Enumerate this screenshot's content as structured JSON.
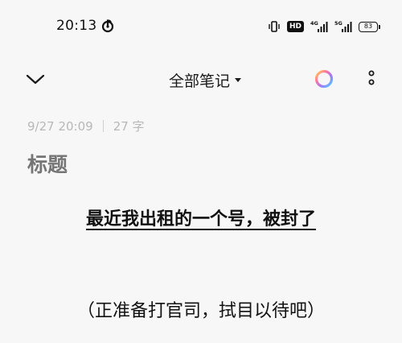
{
  "status_bar": {
    "time": "20:13",
    "hd_label": "HD",
    "net_label_1": "4G",
    "net_label_2": "5G",
    "battery": "83"
  },
  "toolbar": {
    "folder_label": "全部笔记"
  },
  "note": {
    "date": "9/27 20:09",
    "char_count": "27 字",
    "title_placeholder": "标题",
    "title_value": "",
    "body_lines": [
      "最近我出租的一个号，被封了",
      "（正准备打官司，拭目以待吧）"
    ]
  }
}
